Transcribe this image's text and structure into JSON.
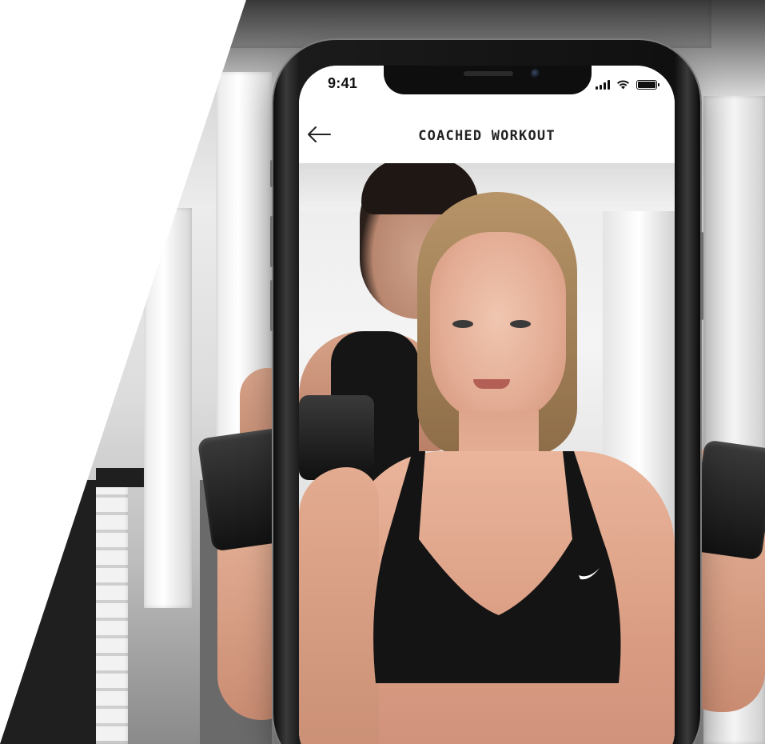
{
  "status_bar": {
    "time": "9:41",
    "icons": [
      "cellular-signal-icon",
      "wifi-icon",
      "battery-icon"
    ]
  },
  "nav": {
    "back_icon": "arrow-left-icon",
    "title": "COACHED WORKOUT"
  },
  "media": {
    "description_icon": "workout-video"
  },
  "colors": {
    "nav_background": "#ffffff",
    "title_text": "#222222",
    "phone_frame": "#101010",
    "bra": "#141414"
  }
}
